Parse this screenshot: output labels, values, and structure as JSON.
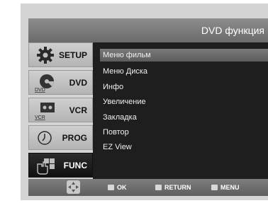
{
  "header": {
    "title": "DVD функция"
  },
  "sidebar": {
    "items": [
      {
        "label": "SETUP",
        "icon": "gear-icon"
      },
      {
        "label": "DVD",
        "icon": "dvd-disc-icon",
        "icon_text": "DVD"
      },
      {
        "label": "VCR",
        "icon": "vcr-tape-icon",
        "icon_text": "VCR"
      },
      {
        "label": "PROG",
        "icon": "timer-clock-icon"
      },
      {
        "label": "FUNC",
        "icon": "hand-pointer-icon",
        "active": true
      }
    ]
  },
  "menu": {
    "items": [
      {
        "label": "Меню фильм",
        "selected": true
      },
      {
        "label": "Меню Диска"
      },
      {
        "label": "Инфо"
      },
      {
        "label": "Увеличение"
      },
      {
        "label": "Закладка"
      },
      {
        "label": "Повтор"
      },
      {
        "label": "EZ View"
      }
    ]
  },
  "footer": {
    "navigate_icon": "four-way-arrow-icon",
    "ok_label": "OK",
    "return_label": "RETURN",
    "menu_label": "MENU"
  },
  "colors": {
    "highlight": "#6c6c6c",
    "content_background": "#1e1e1e",
    "active_tab": "#1a1a1a"
  }
}
